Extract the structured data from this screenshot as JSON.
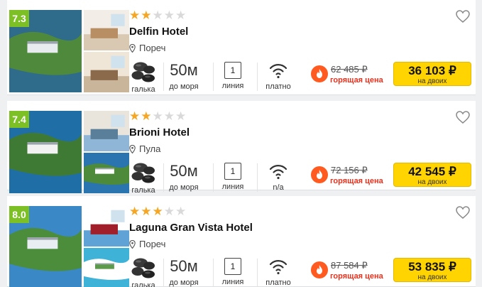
{
  "hotels": [
    {
      "rating": "7.3",
      "stars": 2,
      "name": "Delfin Hotel",
      "city": "Пореч",
      "beach_type": "галька",
      "distance_value": "50м",
      "distance_label": "до моря",
      "line_value": "1",
      "line_label": "линия",
      "wifi_label": "платно",
      "old_price": "62 485 ₽",
      "hot_label": "горящая цена",
      "price": "36 103 ₽",
      "price_note": "на двоих"
    },
    {
      "rating": "7.4",
      "stars": 2,
      "name": "Brioni Hotel",
      "city": "Пула",
      "beach_type": "галька",
      "distance_value": "50м",
      "distance_label": "до моря",
      "line_value": "1",
      "line_label": "линия",
      "wifi_label": "n/a",
      "old_price": "72 156 ₽",
      "hot_label": "горящая цена",
      "price": "42 545 ₽",
      "price_note": "на двоих"
    },
    {
      "rating": "8.0",
      "stars": 3,
      "name": "Laguna Gran Vista Hotel",
      "city": "Пореч",
      "beach_type": "галька",
      "distance_value": "50м",
      "distance_label": "до моря",
      "line_value": "1",
      "line_label": "линия",
      "wifi_label": "платно",
      "old_price": "87 584 ₽",
      "hot_label": "горящая цена",
      "price": "53 835 ₽",
      "price_note": "на двоих"
    }
  ],
  "colors": {
    "rating_badge": "#7cc026",
    "star_on": "#f5a623",
    "star_off": "#d9d9d9",
    "price_button": "#ffd400",
    "hot_text": "#e8321e",
    "fire_icon": "#ff5a1f"
  },
  "icons": {
    "pin": "map-pin-icon",
    "heart": "heart-icon",
    "beach": "pebbles-icon",
    "line": "line-number-icon",
    "wifi": "wifi-icon",
    "fire": "fire-icon"
  }
}
